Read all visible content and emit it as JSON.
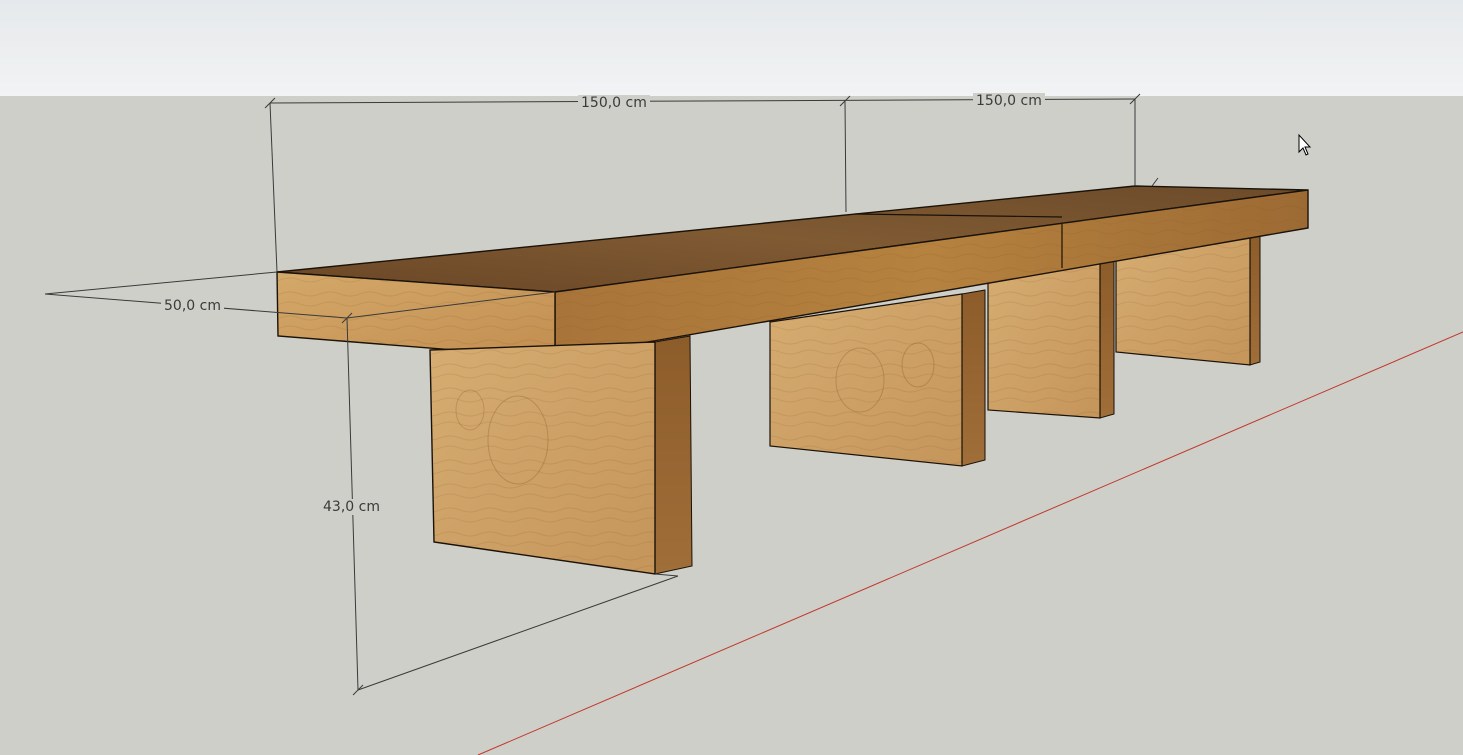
{
  "app": "SketchUp 3D viewport",
  "colors": {
    "sky_top": "#e6e9eb",
    "sky_bottom": "#f1f3f4",
    "ground": "#cfcfca",
    "wood_light": "#c99a5c",
    "wood_mid": "#a6743c",
    "wood_dark": "#6e4a26",
    "wood_top": "#7a5530",
    "edge": "#1a1208",
    "dimension_line": "#3a3a3a",
    "red_axis": "#c0392b"
  },
  "dimensions": {
    "length_left": "150,0 cm",
    "length_right": "150,0 cm",
    "depth": "50,0 cm",
    "height": "43,0 cm"
  },
  "cursor_icon": "arrow-cursor-icon"
}
